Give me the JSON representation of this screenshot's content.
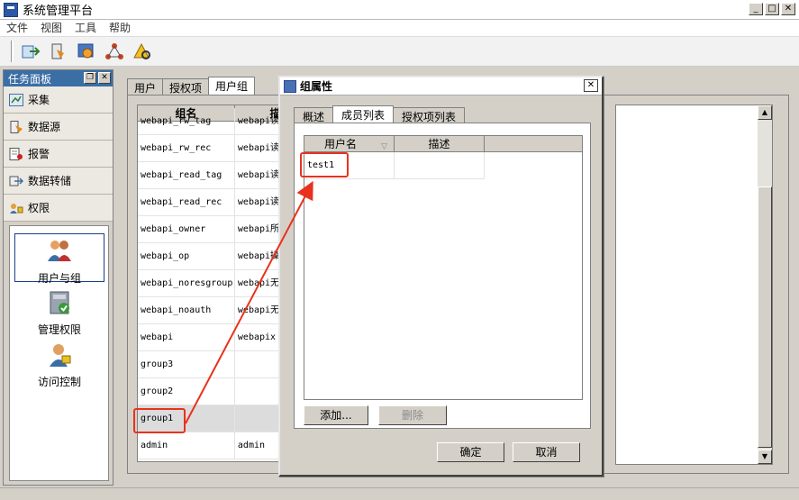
{
  "app": {
    "title": "系统管理平台"
  },
  "menu": [
    "文件",
    "视图",
    "工具",
    "帮助"
  ],
  "toolbar_icons": [
    "import-icon",
    "datasource-tool-icon",
    "settings-tool-icon",
    "network-tool-icon",
    "alarm-tool-icon"
  ],
  "task_panel": {
    "title": "任务面板",
    "items": [
      {
        "label": "采集",
        "icon": "collect-icon"
      },
      {
        "label": "数据源",
        "icon": "datasource-icon"
      },
      {
        "label": "报警",
        "icon": "alarm-icon"
      },
      {
        "label": "数据转储",
        "icon": "transfer-icon"
      },
      {
        "label": "权限",
        "icon": "permission-icon"
      }
    ],
    "sub_items": [
      {
        "label": "用户与组",
        "icon": "users-groups-icon",
        "selected": true
      },
      {
        "label": "管理权限",
        "icon": "admin-permission-icon"
      },
      {
        "label": "访问控制",
        "icon": "access-control-icon"
      }
    ]
  },
  "main": {
    "tabs": [
      "用户",
      "授权项",
      "用户组"
    ],
    "active_tab": "用户组",
    "grid": {
      "columns": [
        "组名",
        "描"
      ],
      "rows": [
        [
          "webapi_rw_tag",
          "webapi读"
        ],
        [
          "webapi_rw_rec",
          "webapi读"
        ],
        [
          "webapi_read_tag",
          "webapi读"
        ],
        [
          "webapi_read_rec",
          "webapi读"
        ],
        [
          "webapi_owner",
          "webapi所"
        ],
        [
          "webapi_op",
          "webapi操"
        ],
        [
          "webapi_noresgroup",
          "webapi无"
        ],
        [
          "webapi_noauth",
          "webapi无"
        ],
        [
          "webapi",
          "webapix"
        ],
        [
          "group3",
          ""
        ],
        [
          "group2",
          ""
        ],
        [
          "group1",
          ""
        ],
        [
          "admin",
          "admin"
        ]
      ],
      "selected_row": "group1"
    }
  },
  "dialog": {
    "title": "组属性",
    "tabs": [
      "概述",
      "成员列表",
      "授权项列表"
    ],
    "active_tab": "成员列表",
    "member_list": {
      "columns": [
        "用户名",
        "描述"
      ],
      "rows": [
        [
          "test1",
          ""
        ]
      ]
    },
    "buttons": {
      "add": "添加...",
      "delete": "删除",
      "ok": "确定",
      "cancel": "取消"
    }
  },
  "colors": {
    "accent": "#3a6ea5",
    "highlight": "#e8321e"
  }
}
